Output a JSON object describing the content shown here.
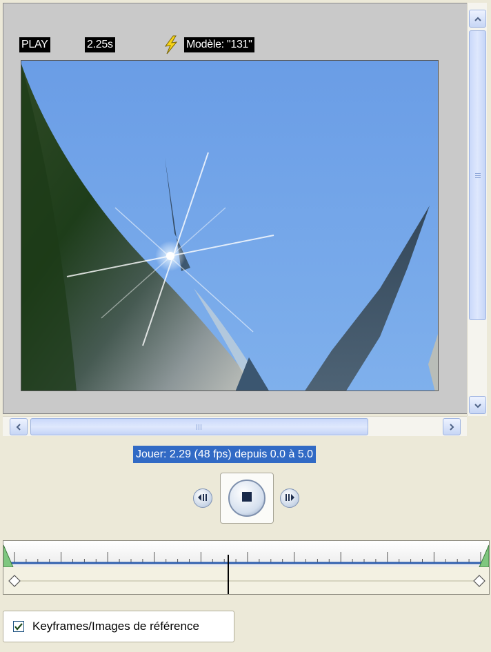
{
  "overlay": {
    "mode": "PLAY",
    "time": "2.25s",
    "model": "Modèle: \"131\"",
    "icon": "lightning-bolt-icon"
  },
  "status": {
    "text": "Jouer: 2.29 (48 fps) depuis 0.0 à 5.0"
  },
  "playback": {
    "prev_icon": "step-back-icon",
    "stop_icon": "stop-icon",
    "next_icon": "step-forward-icon"
  },
  "timeline": {
    "playhead_seconds": 2.29,
    "start_seconds": 0.0,
    "end_seconds": 5.0
  },
  "options": {
    "keyframes_label": "Keyframes/Images de référence",
    "keyframes_checked": true
  },
  "colors": {
    "status_bg": "#316ac5",
    "sky": "#73a4e6",
    "playhead": "#000000"
  }
}
